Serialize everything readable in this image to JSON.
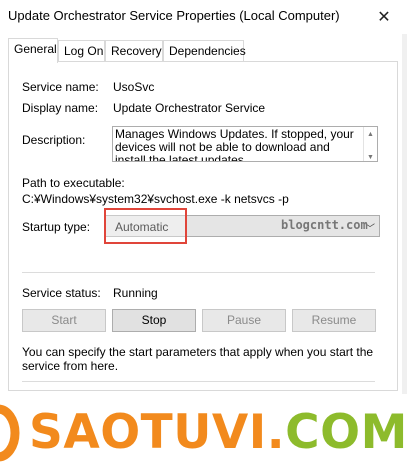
{
  "window": {
    "title": "Update Orchestrator Service Properties (Local Computer)",
    "close_icon": "close-icon"
  },
  "tabs": [
    {
      "label": "General",
      "active": true
    },
    {
      "label": "Log On",
      "active": false
    },
    {
      "label": "Recovery",
      "active": false
    },
    {
      "label": "Dependencies",
      "active": false
    }
  ],
  "general": {
    "service_name_label": "Service name:",
    "service_name_value": "UsoSvc",
    "display_name_label": "Display name:",
    "display_name_value": "Update Orchestrator Service",
    "description_label": "Description:",
    "description_value": "Manages Windows Updates. If stopped, your devices will not be able to download and install the latest updates.",
    "path_label": "Path to executable:",
    "path_value": "C:¥Windows¥system32¥svchost.exe -k netsvcs -p",
    "startup_type_label": "Startup type:",
    "startup_type_value": "Automatic",
    "watermark": "blogcntt.com",
    "service_status_label": "Service status:",
    "service_status_value": "Running",
    "buttons": {
      "start": "Start",
      "stop": "Stop",
      "pause": "Pause",
      "resume": "Resume"
    },
    "hint": "You can specify the start parameters that apply when you start the service from here."
  },
  "banner": {
    "part1": "SAOTUVI",
    "part2": ".",
    "part3": "COM",
    "colors": {
      "orange": "#f28a1d",
      "green": "#8dbb2c"
    }
  },
  "highlight_color": "#e0453a"
}
